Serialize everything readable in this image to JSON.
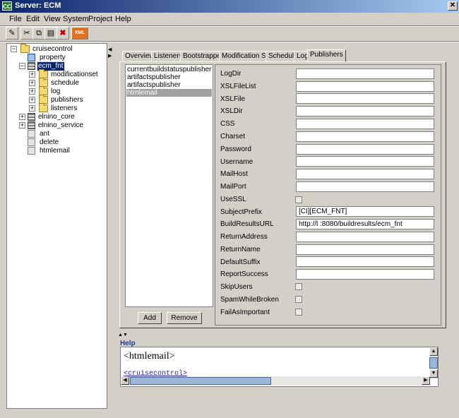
{
  "window": {
    "icon_text": "CC",
    "title": "Server: ECM"
  },
  "menu": [
    "File",
    "Edit",
    "View",
    "System",
    "Project",
    "Help"
  ],
  "toolbar": {
    "xml_label": "XML"
  },
  "tree": {
    "nodes": [
      {
        "label": "cruisecontrol"
      },
      {
        "label": "property"
      },
      {
        "label": "ecm_fnt"
      },
      {
        "label": "modificationset"
      },
      {
        "label": "schedule"
      },
      {
        "label": "log"
      },
      {
        "label": "publishers"
      },
      {
        "label": "listeners"
      },
      {
        "label": "elnino_core"
      },
      {
        "label": "elnino_service"
      },
      {
        "label": "ant"
      },
      {
        "label": "delete"
      },
      {
        "label": "htmlemail"
      }
    ]
  },
  "tabs": [
    "Overview",
    "Listeners",
    "Bootstrappers",
    "Modification Sets",
    "Schedule",
    "Log",
    "Publishers"
  ],
  "publishers": [
    "currentbuildstatuspublisher",
    "artifactspublisher",
    "artifactspublisher",
    "htmlemail"
  ],
  "buttons": {
    "add": "Add",
    "remove": "Remove"
  },
  "properties": [
    {
      "label": "LogDir",
      "value": ""
    },
    {
      "label": "XSLFileList",
      "value": ""
    },
    {
      "label": "XSLFile",
      "value": ""
    },
    {
      "label": "XSLDir",
      "value": ""
    },
    {
      "label": "CSS",
      "value": ""
    },
    {
      "label": "Charset",
      "value": ""
    },
    {
      "label": "Password",
      "value": ""
    },
    {
      "label": "Username",
      "value": ""
    },
    {
      "label": "MailHost",
      "value": ""
    },
    {
      "label": "MailPort",
      "value": ""
    },
    {
      "label": "UseSSL",
      "value": ""
    },
    {
      "label": "SubjectPrefix",
      "value": "[CI][ECM_FNT]"
    },
    {
      "label": "BuildResultsURL",
      "value": "http://l         :8080/buildresults/ecm_fnt"
    },
    {
      "label": "ReturnAddress",
      "value": ""
    },
    {
      "label": "ReturnName",
      "value": ""
    },
    {
      "label": "DefaultSuffix",
      "value": ""
    },
    {
      "label": "ReportSuccess",
      "value": ""
    },
    {
      "label": "SkipUsers",
      "value": ""
    },
    {
      "label": "SpamWhileBroken",
      "value": ""
    },
    {
      "label": "FailAsImportant",
      "value": ""
    }
  ],
  "help": {
    "title": "Help",
    "heading": "<htmlemail>",
    "link": "<cruisecontrol>"
  }
}
